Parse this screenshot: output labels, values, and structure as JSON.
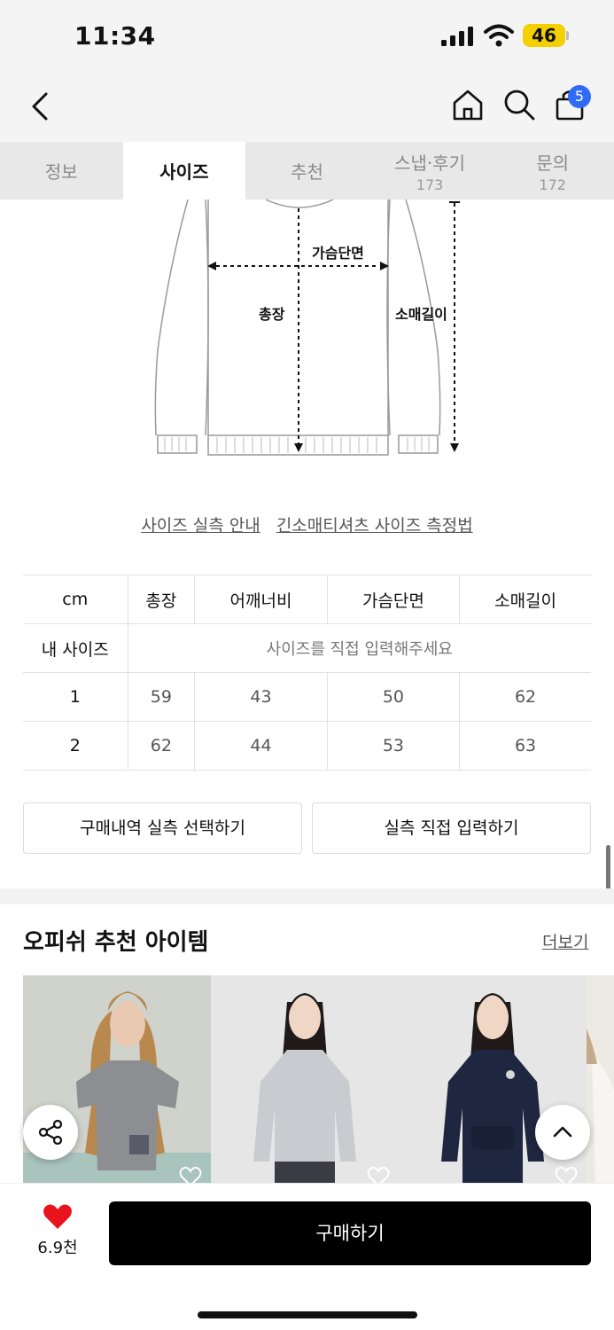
{
  "status": {
    "time": "11:34",
    "battery": "46"
  },
  "header": {
    "cart_count": "5"
  },
  "tabs": [
    {
      "label": "정보",
      "count": ""
    },
    {
      "label": "사이즈",
      "count": ""
    },
    {
      "label": "추천",
      "count": ""
    },
    {
      "label": "스냅·후기",
      "count": "173"
    },
    {
      "label": "문의",
      "count": "172"
    }
  ],
  "diagram": {
    "chest": "가슴단면",
    "length": "총장",
    "sleeve": "소매길이"
  },
  "links": {
    "guide": "사이즈 실측 안내",
    "measure": "긴소매티셔츠 사이즈 측정법"
  },
  "table": {
    "unit": "cm",
    "headers": [
      "총장",
      "어깨너비",
      "가슴단면",
      "소매길이"
    ],
    "my_size_label": "내 사이즈",
    "my_size_prompt": "사이즈를 직접 입력해주세요",
    "rows": [
      {
        "size": "1",
        "values": [
          "59",
          "43",
          "50",
          "62"
        ]
      },
      {
        "size": "2",
        "values": [
          "62",
          "44",
          "53",
          "63"
        ]
      }
    ]
  },
  "buttons": {
    "purchase_history": "구매내역 실측 선택하기",
    "direct_input": "실측 직접 입력하기"
  },
  "recommend": {
    "title": "오피쉬 추천 아이템",
    "more": "더보기"
  },
  "bottom": {
    "like_count": "6.9천",
    "buy_label": "구매하기"
  },
  "colors": {
    "accent_blue": "#2f6bf5",
    "heart_red": "#e8131d",
    "battery_yellow": "#f5d000"
  }
}
